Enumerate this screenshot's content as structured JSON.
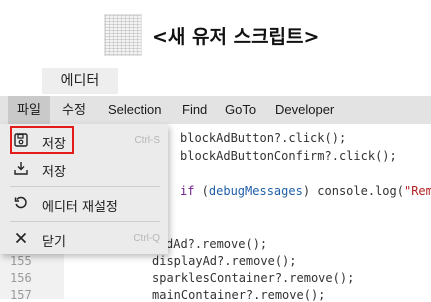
{
  "header": {
    "script_title": "<새 유저 스크립트>"
  },
  "tabs": [
    {
      "label": "에디터",
      "active": true
    }
  ],
  "menubar": {
    "items": [
      "파일",
      "수정",
      "Selection",
      "Find",
      "GoTo",
      "Developer"
    ]
  },
  "file_menu": {
    "items": [
      {
        "label": "저장",
        "shortcut": "Ctrl-S",
        "icon": "save-icon"
      },
      {
        "label": "저장",
        "shortcut": "",
        "icon": "save-download-icon"
      },
      {
        "label": "에디터 재설정",
        "shortcut": "",
        "icon": "reset-icon"
      },
      {
        "label": "닫기",
        "shortcut": "Ctrl-Q",
        "icon": "close-icon"
      }
    ]
  },
  "editor": {
    "visible_line_numbers": [
      "155",
      "156",
      "157"
    ],
    "code_lines": {
      "l0": "blockAdButton?.click();",
      "l1": "blockAdButtonConfirm?.click();",
      "l2_kw": "if",
      "l2_mid": " (",
      "l2_var": "debugMessages",
      "l2_rest": ") console.log(",
      "l2_str": "\"Remo",
      "l3": "dAd?.remove();",
      "l4": "displayAd?.remove();",
      "l5": "sparklesContainer?.remove();",
      "l6": "mainContainer?.remove();"
    }
  },
  "colors": {
    "highlight": "#e21b1b",
    "keyword": "#6e1c8e",
    "string": "#b22222"
  }
}
